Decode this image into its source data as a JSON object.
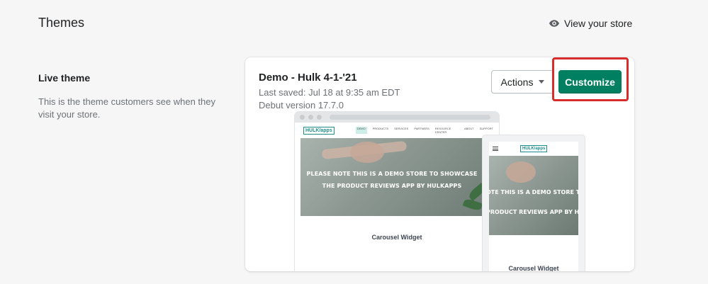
{
  "header": {
    "title": "Themes",
    "view_store_label": "View your store",
    "view_store_icon": "eye-icon"
  },
  "live_theme": {
    "section_title": "Live theme",
    "section_description": "This is the theme customers see when they visit your store."
  },
  "theme_card": {
    "name": "Demo - Hulk 4-1-'21",
    "last_saved": "Last saved: Jul 18 at 9:35 am EDT",
    "version": "Debut version 17.7.0",
    "actions_label": "Actions",
    "customize_label": "Customize",
    "customize_color": "#008060",
    "highlight_color": "#d82c2c"
  },
  "preview": {
    "logo": "HULK/apps",
    "nav_links": [
      "DEMO",
      "PRODUCTS",
      "SERVICES",
      "PARTNERS",
      "RESOURCE CENTER",
      "ABOUT",
      "SUPPORT"
    ],
    "hero_line1": "PLEASE NOTE THIS IS A DEMO STORE TO SHOWCASE",
    "hero_line2": "THE PRODUCT REVIEWS APP BY HULKAPPS",
    "carousel_label": "Carousel Widget",
    "mobile_hero_line1": "OTE THIS IS A DEMO STORE TO S",
    "mobile_hero_line2": "PRODUCT REVIEWS APP BY HULK",
    "mobile_carousel_label": "Carousel Widget"
  }
}
